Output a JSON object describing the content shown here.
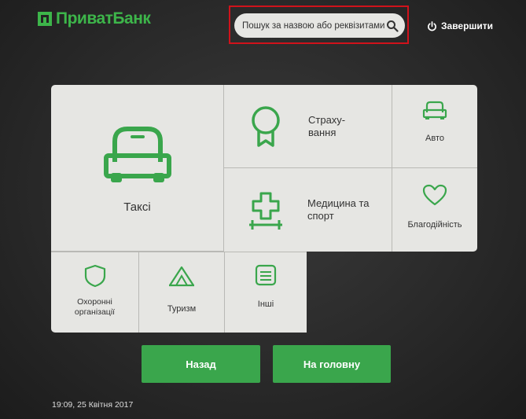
{
  "brand": {
    "name": "ПриватБанк",
    "color": "#3db54a"
  },
  "header": {
    "search_placeholder": "Пошук за назвою або реквізитами",
    "finish_label": "Завершити"
  },
  "tiles": {
    "taxi": "Таксі",
    "insurance": [
      "Страху-",
      "вання"
    ],
    "auto": "Авто",
    "medicine": [
      "Медицина та",
      "спорт"
    ],
    "charity": "Благодійність",
    "security": [
      "Охоронні",
      "організації"
    ],
    "tourism": "Туризм",
    "other": "Інші"
  },
  "buttons": {
    "back": "Назад",
    "home": "На головну"
  },
  "footer": {
    "datetime": "19:09,  25 Квітня 2017"
  },
  "colors": {
    "accent": "#3aa64c",
    "highlight": "#d0121b",
    "tile_bg": "#e6e6e3"
  },
  "icons": [
    "search-icon",
    "power-icon",
    "car-icon",
    "medal-icon",
    "medical-cross-icon",
    "heart-icon",
    "shield-icon",
    "tent-icon",
    "document-icon"
  ]
}
